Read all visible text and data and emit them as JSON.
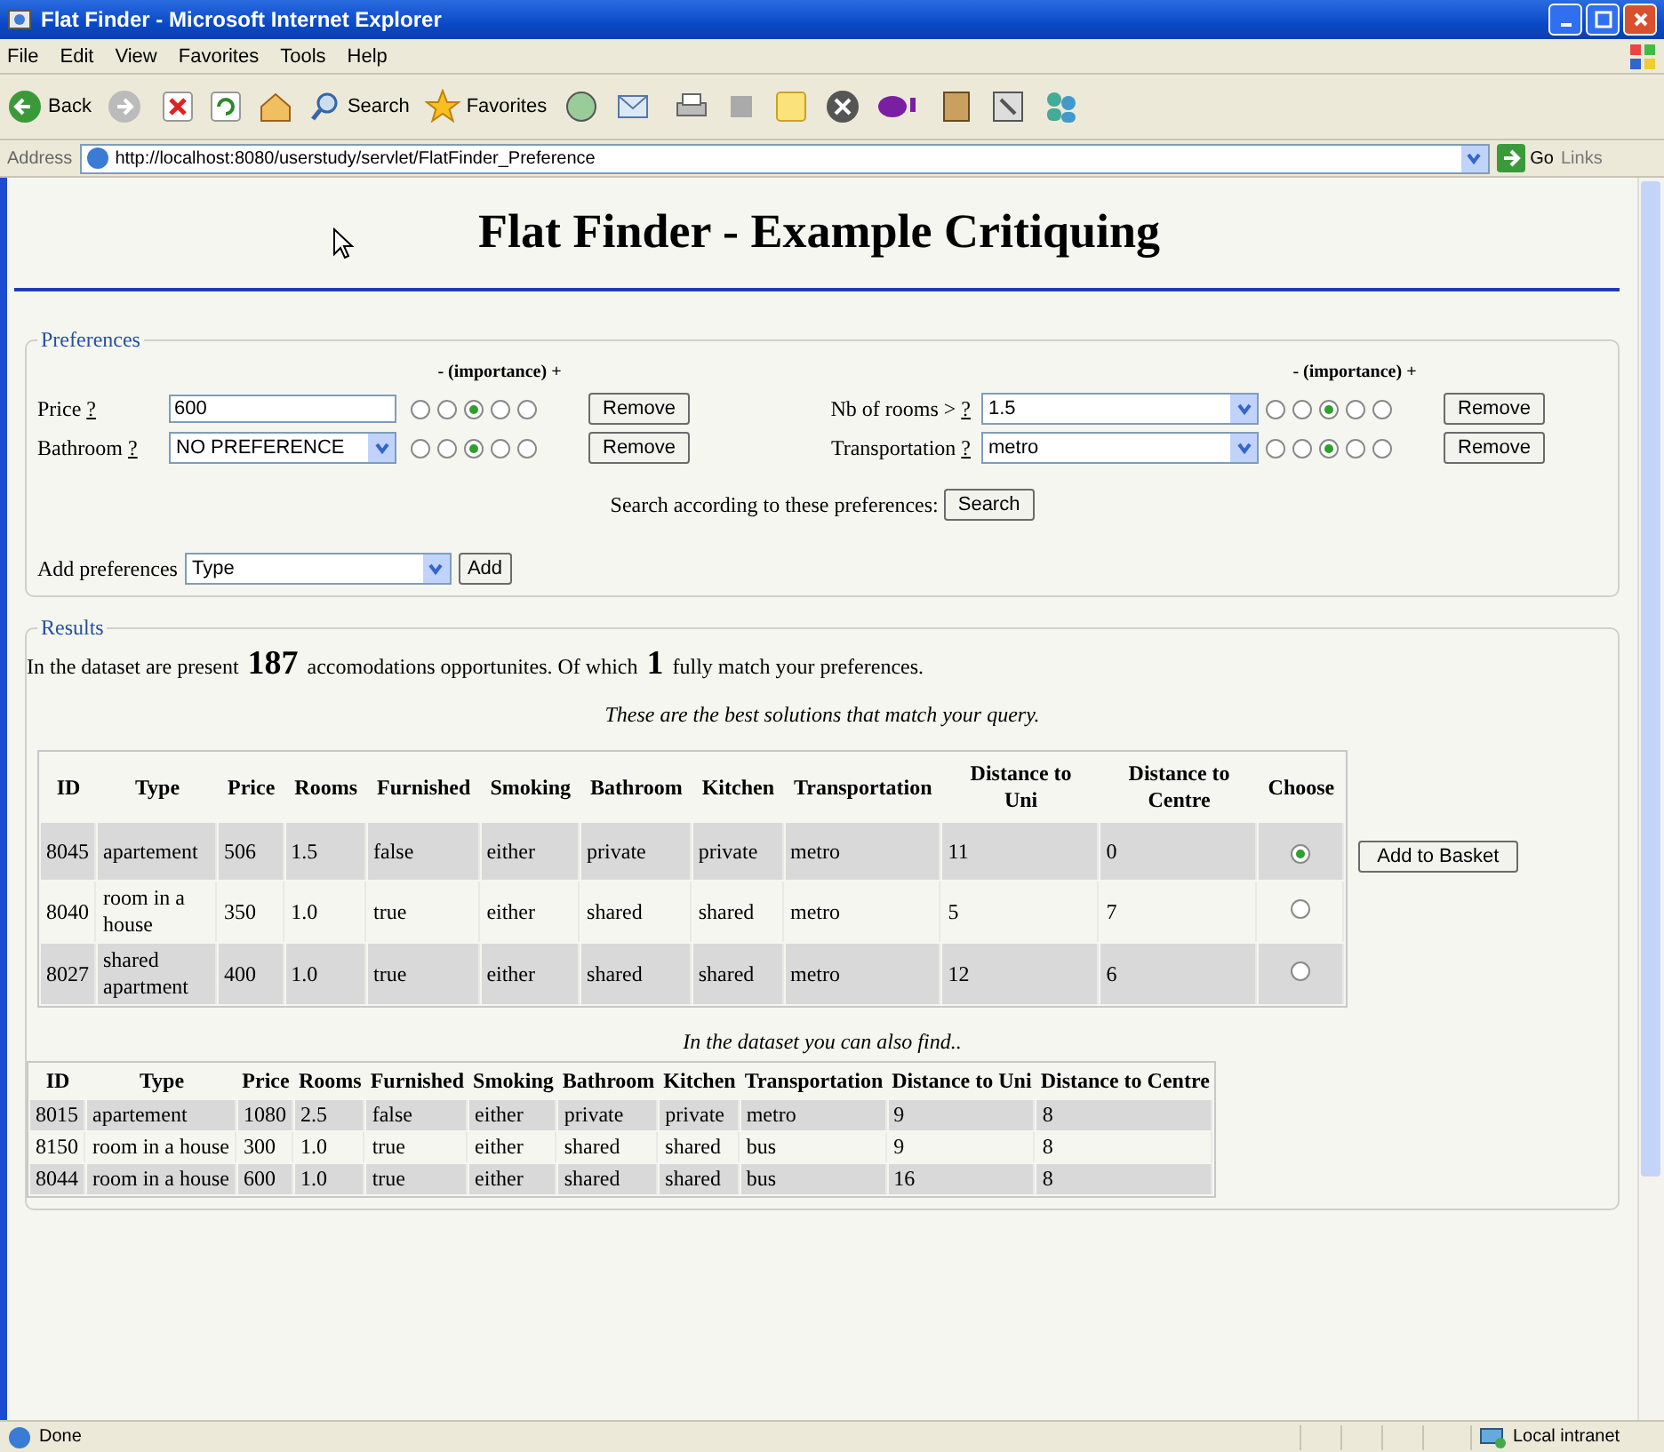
{
  "window": {
    "title": "Flat Finder - Microsoft Internet Explorer"
  },
  "menu": [
    "File",
    "Edit",
    "View",
    "Favorites",
    "Tools",
    "Help"
  ],
  "toolbar": {
    "back": "Back",
    "search": "Search",
    "favorites": "Favorites"
  },
  "address": {
    "label": "Address",
    "value": "http://localhost:8080/userstudy/servlet/FlatFinder_Preference",
    "go": "Go",
    "links": "Links"
  },
  "page": {
    "heading": "Flat Finder - Example Critiquing",
    "preferences": {
      "legend": "Preferences",
      "importance_labels": [
        "- (importance) +",
        "- (importance) +"
      ],
      "items": [
        {
          "label": "Price",
          "help": "?",
          "kind": "text",
          "value": "600",
          "importance": [
            {
              "selected": false
            },
            {
              "selected": false
            },
            {
              "selected": true
            },
            {
              "selected": false
            },
            {
              "selected": false
            }
          ],
          "remove": "Remove"
        },
        {
          "label": "Nb of rooms >",
          "help": "?",
          "kind": "select",
          "value": "1.5",
          "importance": [
            {
              "selected": false
            },
            {
              "selected": false
            },
            {
              "selected": true
            },
            {
              "selected": false
            },
            {
              "selected": false
            }
          ],
          "remove": "Remove"
        },
        {
          "label": "Bathroom",
          "help": "?",
          "kind": "select",
          "value": "NO PREFERENCE",
          "importance": [
            {
              "selected": false
            },
            {
              "selected": false
            },
            {
              "selected": true
            },
            {
              "selected": false
            },
            {
              "selected": false
            }
          ],
          "remove": "Remove"
        },
        {
          "label": "Transportation",
          "help": "?",
          "kind": "select",
          "value": "metro",
          "importance": [
            {
              "selected": false
            },
            {
              "selected": false
            },
            {
              "selected": true
            },
            {
              "selected": false
            },
            {
              "selected": false
            }
          ],
          "remove": "Remove"
        }
      ],
      "search_prompt": "Search according to these preferences:",
      "search_button": "Search",
      "add_label": "Add preferences",
      "add_value": "Type",
      "add_button": "Add"
    },
    "results": {
      "legend": "Results",
      "summary": "In the dataset are present **187** accomodations opportunites. Of which **1** fully match your preferences.",
      "best_caption": "These are the best solutions that match your query.",
      "best_table": {
        "columns": [
          "ID",
          "Type",
          "Price",
          "Rooms",
          "Furnished",
          "Smoking",
          "Bathroom",
          "Kitchen",
          "Transportation",
          "Distance to Uni",
          "Distance to Centre",
          "Choose"
        ],
        "rows": [
          {
            "cells": [
              "8045",
              "apartement",
              "506",
              "1.5",
              "false",
              "either",
              "private",
              "private",
              "metro",
              "11",
              "0"
            ],
            "selected": true
          },
          {
            "cells": [
              "8040",
              "room in a house",
              "350",
              "1.0",
              "true",
              "either",
              "shared",
              "shared",
              "metro",
              "5",
              "7"
            ],
            "selected": false
          },
          {
            "cells": [
              "8027",
              "shared apartment",
              "400",
              "1.0",
              "true",
              "either",
              "shared",
              "shared",
              "metro",
              "12",
              "6"
            ],
            "selected": false
          }
        ]
      },
      "basket_button": "Add to Basket",
      "more_caption": "In the dataset you can also find..",
      "more_table": {
        "columns": [
          "ID",
          "Type",
          "Price",
          "Rooms",
          "Furnished",
          "Smoking",
          "Bathroom",
          "Kitchen",
          "Transportation",
          "Distance to Uni",
          "Distance to Centre"
        ],
        "rows": [
          {
            "cells": [
              "8015",
              "apartement",
              "1080",
              "2.5",
              "false",
              "either",
              "private",
              "private",
              "metro",
              "9",
              "8"
            ]
          },
          {
            "cells": [
              "8150",
              "room in a house",
              "300",
              "1.0",
              "true",
              "either",
              "shared",
              "shared",
              "bus",
              "9",
              "8"
            ]
          },
          {
            "cells": [
              "8044",
              "room in a house",
              "600",
              "1.0",
              "true",
              "either",
              "shared",
              "shared",
              "bus",
              "16",
              "8"
            ]
          }
        ]
      }
    }
  },
  "status_bar": {
    "text": "Done",
    "zone": "Local intranet"
  }
}
